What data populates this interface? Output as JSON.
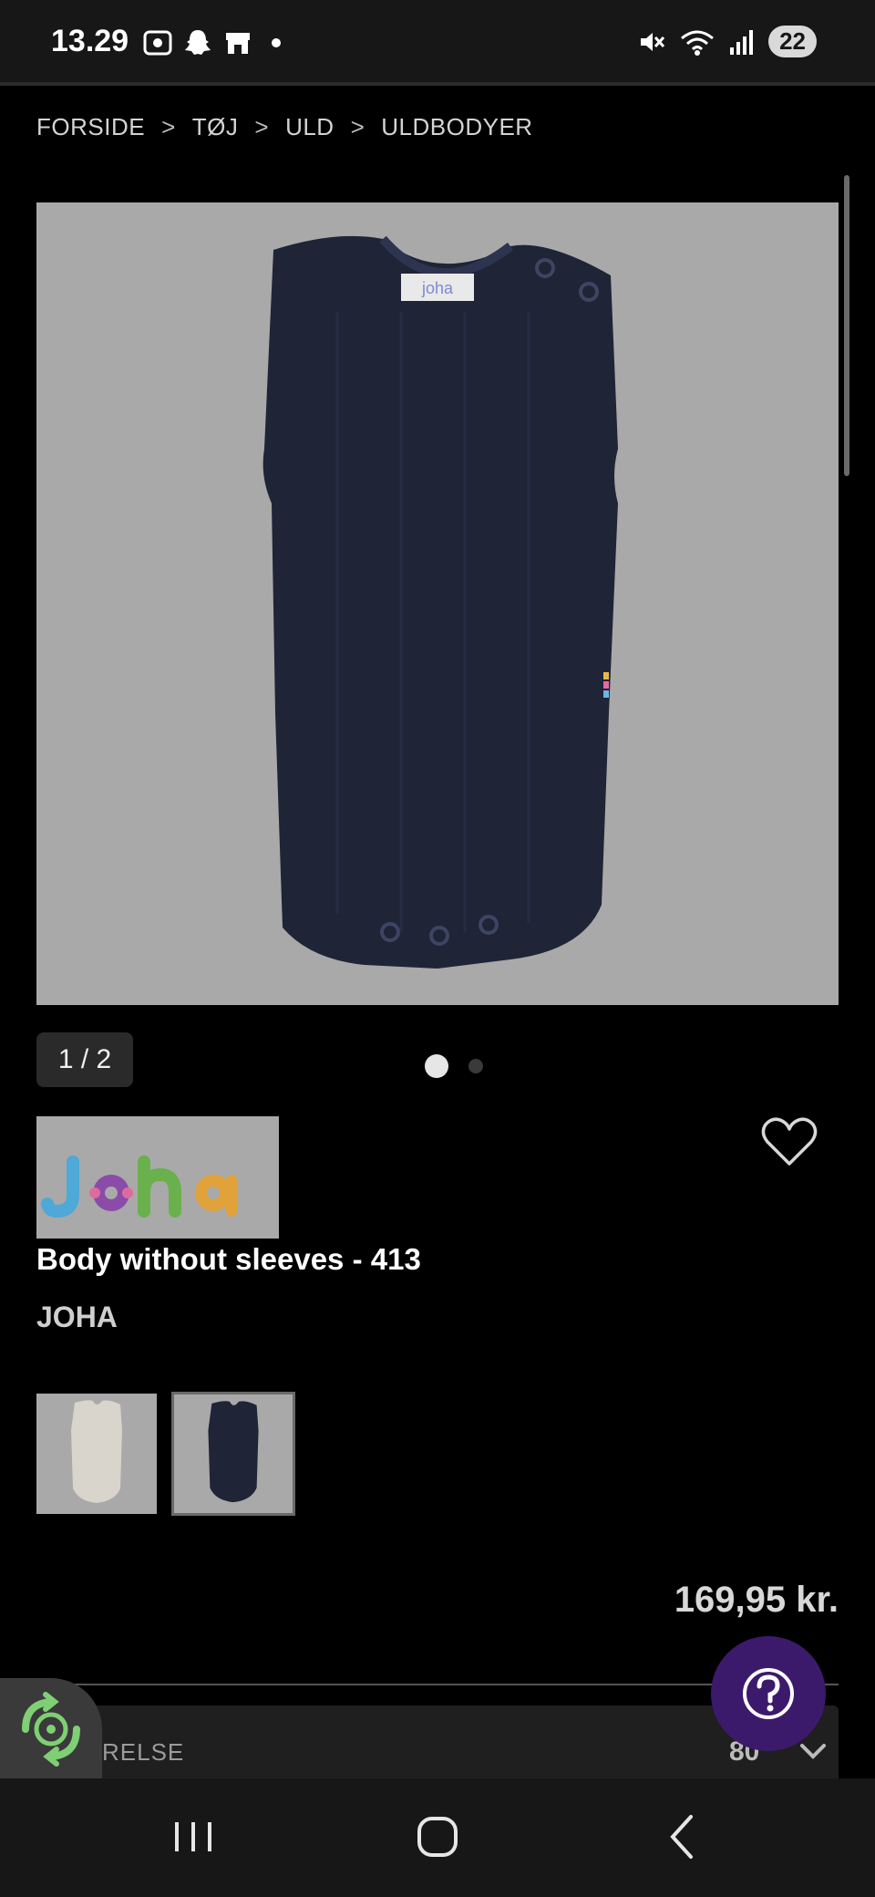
{
  "status_bar": {
    "time": "13.29",
    "battery": "22",
    "left_icons": [
      "screenshot-icon",
      "snapchat-icon",
      "store-icon"
    ],
    "right_icons": [
      "mute-icon",
      "wifi-icon",
      "signal-icon"
    ]
  },
  "breadcrumb": {
    "items": [
      "FORSIDE",
      "TØJ",
      "ULD",
      "ULDBODYER"
    ],
    "separator": ">"
  },
  "gallery": {
    "counter": "1 / 2",
    "total_dots": 2,
    "active_dot": 1
  },
  "product": {
    "title": "Body without sleeves - 413",
    "brand": "JOHA",
    "price": "169,95 kr."
  },
  "size_selector": {
    "label_partial": "RELSE",
    "value_partial": "80"
  },
  "colors": {
    "background": "#000000",
    "image_bg": "#a9a9a9",
    "garment": "#1f2436",
    "help_button": "#3c1a6b",
    "eco_accent": "#7fcf74"
  }
}
